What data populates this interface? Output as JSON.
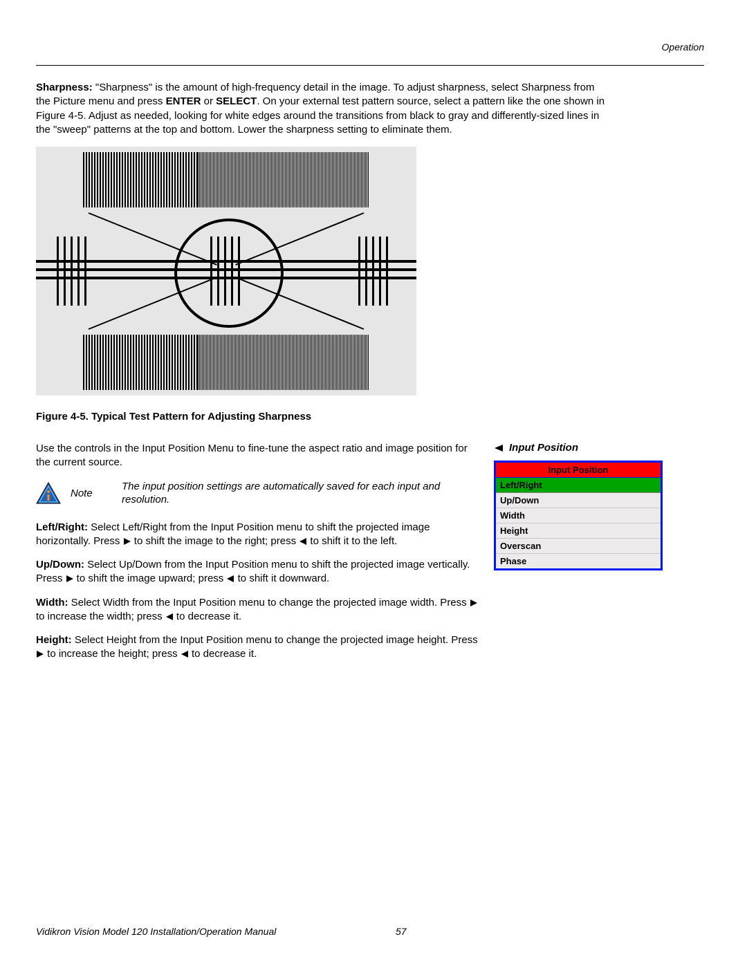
{
  "header": {
    "section": "Operation"
  },
  "sharpness": {
    "label": "Sharpness:",
    "text1": " \"Sharpness\" is the amount of high-frequency detail in the image. To adjust sharpness, select Sharpness from the Picture menu and press ",
    "bold1": "ENTER",
    "text1b": " or ",
    "bold2": "SELECT",
    "text1c": ". On your external test pattern source, select a pattern like the one shown in Figure 4-5. Adjust as needed, looking for white edges around the transitions from black to gray and differently-sized lines in the \"sweep\" patterns at the top and bottom. Lower the sharpness setting to eliminate them."
  },
  "figure_caption": "Figure 4-5. Typical Test Pattern for Adjusting Sharpness",
  "intro_input_position": "Use the controls in the Input Position Menu to fine-tune the aspect ratio and image position for the current source.",
  "note": {
    "label": "Note",
    "text": "The input position settings are automatically saved for each input and resolution."
  },
  "leftright": {
    "label": "Left/Right:",
    "t1": " Select Left/Right from the Input Position menu to shift the projected image horizontally. Press ",
    "t2": " to shift the image to the right; press ",
    "t3": " to shift it to the left."
  },
  "updown": {
    "label": "Up/Down:",
    "t1": " Select Up/Down from the Input Position menu to shift the projected image vertically. Press ",
    "t2": " to shift the image upward; press ",
    "t3": " to shift it downward."
  },
  "width": {
    "label": "Width:",
    "t1": " Select Width from the Input Position menu to change the projected image width. Press ",
    "t2": " to increase the width; press ",
    "t3": " to decrease it."
  },
  "height": {
    "label": "Height:",
    "t1": " Select Height from the Input Position menu to change the projected image height. Press ",
    "t2": " to increase the height; press ",
    "t3": " to decrease it."
  },
  "sidebar": {
    "heading": "Input Position",
    "menu_title": "Input Position",
    "items": [
      "Left/Right",
      "Up/Down",
      "Width",
      "Height",
      "Overscan",
      "Phase"
    ]
  },
  "footer": {
    "title": "Vidikron Vision Model 120 Installation/Operation Manual",
    "page": "57"
  }
}
